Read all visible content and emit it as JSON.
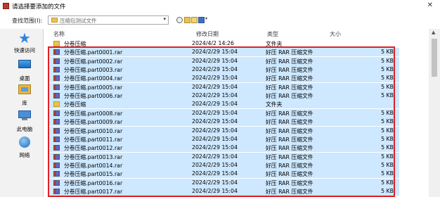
{
  "window": {
    "title": "请选择要添加的文件"
  },
  "address": {
    "look_in_label": "查找范围(I):",
    "current_folder": "压缩包测试文件"
  },
  "places": [
    {
      "label": "快速访问",
      "icon": "star-icon"
    },
    {
      "label": "桌面",
      "icon": "desktop-icon"
    },
    {
      "label": "库",
      "icon": "library-icon"
    },
    {
      "label": "此电脑",
      "icon": "computer-icon"
    },
    {
      "label": "网络",
      "icon": "network-icon"
    }
  ],
  "columns": {
    "name": "名称",
    "date": "修改日期",
    "type": "类型",
    "size": "大小"
  },
  "files": [
    {
      "name": "分卷压缩",
      "date": "2024/4/2 14:26",
      "type": "文件夹",
      "size": "",
      "kind": "folder",
      "selected": false
    },
    {
      "name": "分卷压缩.part0001.rar",
      "date": "2024/2/29 15:04",
      "type": "好压 RAR 压缩文件",
      "size": "5 KB",
      "kind": "rar",
      "selected": true
    },
    {
      "name": "分卷压缩.part0002.rar",
      "date": "2024/2/29 15:04",
      "type": "好压 RAR 压缩文件",
      "size": "5 KB",
      "kind": "rar",
      "selected": true
    },
    {
      "name": "分卷压缩.part0003.rar",
      "date": "2024/2/29 15:04",
      "type": "好压 RAR 压缩文件",
      "size": "5 KB",
      "kind": "rar",
      "selected": true
    },
    {
      "name": "分卷压缩.part0004.rar",
      "date": "2024/2/29 15:04",
      "type": "好压 RAR 压缩文件",
      "size": "5 KB",
      "kind": "rar",
      "selected": true
    },
    {
      "name": "分卷压缩.part0005.rar",
      "date": "2024/2/29 15:04",
      "type": "好压 RAR 压缩文件",
      "size": "5 KB",
      "kind": "rar",
      "selected": true
    },
    {
      "name": "分卷压缩.part0006.rar",
      "date": "2024/2/29 15:04",
      "type": "好压 RAR 压缩文件",
      "size": "5 KB",
      "kind": "rar",
      "selected": true
    },
    {
      "name": "分卷压缩",
      "date": "2024/2/29 15:04",
      "type": "文件夹",
      "size": "",
      "kind": "folder",
      "selected": true
    },
    {
      "name": "分卷压缩.part0008.rar",
      "date": "2024/2/29 15:04",
      "type": "好压 RAR 压缩文件",
      "size": "5 KB",
      "kind": "rar",
      "selected": true
    },
    {
      "name": "分卷压缩.part0009.rar",
      "date": "2024/2/29 15:04",
      "type": "好压 RAR 压缩文件",
      "size": "5 KB",
      "kind": "rar",
      "selected": true
    },
    {
      "name": "分卷压缩.part0010.rar",
      "date": "2024/2/29 15:04",
      "type": "好压 RAR 压缩文件",
      "size": "5 KB",
      "kind": "rar",
      "selected": true
    },
    {
      "name": "分卷压缩.part0011.rar",
      "date": "2024/2/29 15:04",
      "type": "好压 RAR 压缩文件",
      "size": "5 KB",
      "kind": "rar",
      "selected": true
    },
    {
      "name": "分卷压缩.part0012.rar",
      "date": "2024/2/29 15:04",
      "type": "好压 RAR 压缩文件",
      "size": "5 KB",
      "kind": "rar",
      "selected": true
    },
    {
      "name": "分卷压缩.part0013.rar",
      "date": "2024/2/29 15:04",
      "type": "好压 RAR 压缩文件",
      "size": "5 KB",
      "kind": "rar",
      "selected": true
    },
    {
      "name": "分卷压缩.part0014.rar",
      "date": "2024/2/29 15:04",
      "type": "好压 RAR 压缩文件",
      "size": "5 KB",
      "kind": "rar",
      "selected": true
    },
    {
      "name": "分卷压缩.part0015.rar",
      "date": "2024/2/29 15:04",
      "type": "好压 RAR 压缩文件",
      "size": "5 KB",
      "kind": "rar",
      "selected": true
    },
    {
      "name": "分卷压缩.part0016.rar",
      "date": "2024/2/29 15:04",
      "type": "好压 RAR 压缩文件",
      "size": "5 KB",
      "kind": "rar",
      "selected": true
    },
    {
      "name": "分卷压缩.part0017.rar",
      "date": "2024/2/29 15:04",
      "type": "好压 RAR 压缩文件",
      "size": "5 KB",
      "kind": "rar",
      "selected": true
    }
  ],
  "colors": {
    "selection": "#cde8ff",
    "highlight_box": "#e0202a",
    "folder": "#e8c253"
  }
}
